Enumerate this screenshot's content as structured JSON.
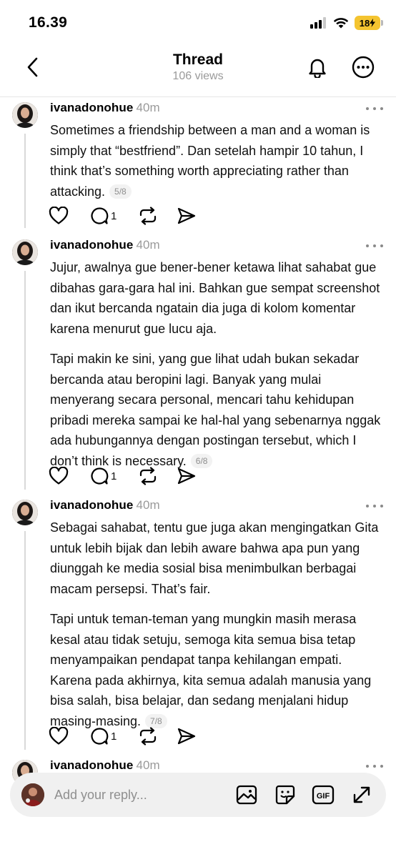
{
  "status_bar": {
    "time": "16.39",
    "battery": "18"
  },
  "header": {
    "title": "Thread",
    "views": "106 views"
  },
  "posts": [
    {
      "username": "ivanadonohue",
      "time": "40m",
      "paragraphs": [
        "Sometimes a friendship between a man and a woman is simply that “bestfriend”. Dan setelah hampir 10 tahun, I think that’s something worth appreciating rather than attacking."
      ],
      "page": "5/8",
      "replies": "1"
    },
    {
      "username": "ivanadonohue",
      "time": "40m",
      "paragraphs": [
        "Jujur, awalnya gue bener-bener ketawa lihat sahabat gue dibahas gara-gara hal ini. Bahkan gue sempat screenshot dan ikut bercanda ngatain dia juga di kolom komentar karena menurut gue lucu aja.",
        "Tapi makin ke sini, yang gue lihat udah bukan sekadar bercanda atau beropini lagi. Banyak yang mulai menyerang secara personal, mencari tahu kehidupan pribadi mereka sampai ke hal-hal yang sebenarnya nggak ada hubungannya dengan postingan tersebut, which I don’t think is necessary."
      ],
      "page": "6/8",
      "replies": "1"
    },
    {
      "username": "ivanadonohue",
      "time": "40m",
      "paragraphs": [
        "Sebagai sahabat, tentu gue juga akan mengingatkan Gita untuk lebih bijak dan lebih aware bahwa apa pun yang diunggah ke media sosial bisa menimbulkan berbagai macam persepsi. That’s fair.",
        "Tapi untuk teman-teman yang mungkin masih merasa kesal atau tidak setuju, semoga kita semua bisa tetap menyampaikan pendapat tanpa kehilangan empati. Karena pada akhirnya, kita semua adalah manusia yang bisa salah, bisa belajar, dan sedang menjalani hidup masing-masing."
      ],
      "page": "7/8",
      "replies": "1"
    },
    {
      "username": "ivanadonohue",
      "time": "40m"
    }
  ],
  "reply_bar": {
    "placeholder": "Add your reply...",
    "gif_label": "GIF"
  },
  "icons": {
    "back": "chevron-left-icon",
    "bell": "bell-icon",
    "more": "more-horizontal-icon",
    "like": "heart-icon",
    "reply": "comment-icon",
    "repost": "repost-icon",
    "share": "send-icon",
    "image": "image-icon",
    "sticker": "sticker-icon",
    "gif": "gif-icon",
    "expand": "expand-icon"
  },
  "colors": {
    "battery": "#f4c430",
    "muted_text": "#9a9a9a",
    "thread_line": "#d9d9d9"
  }
}
